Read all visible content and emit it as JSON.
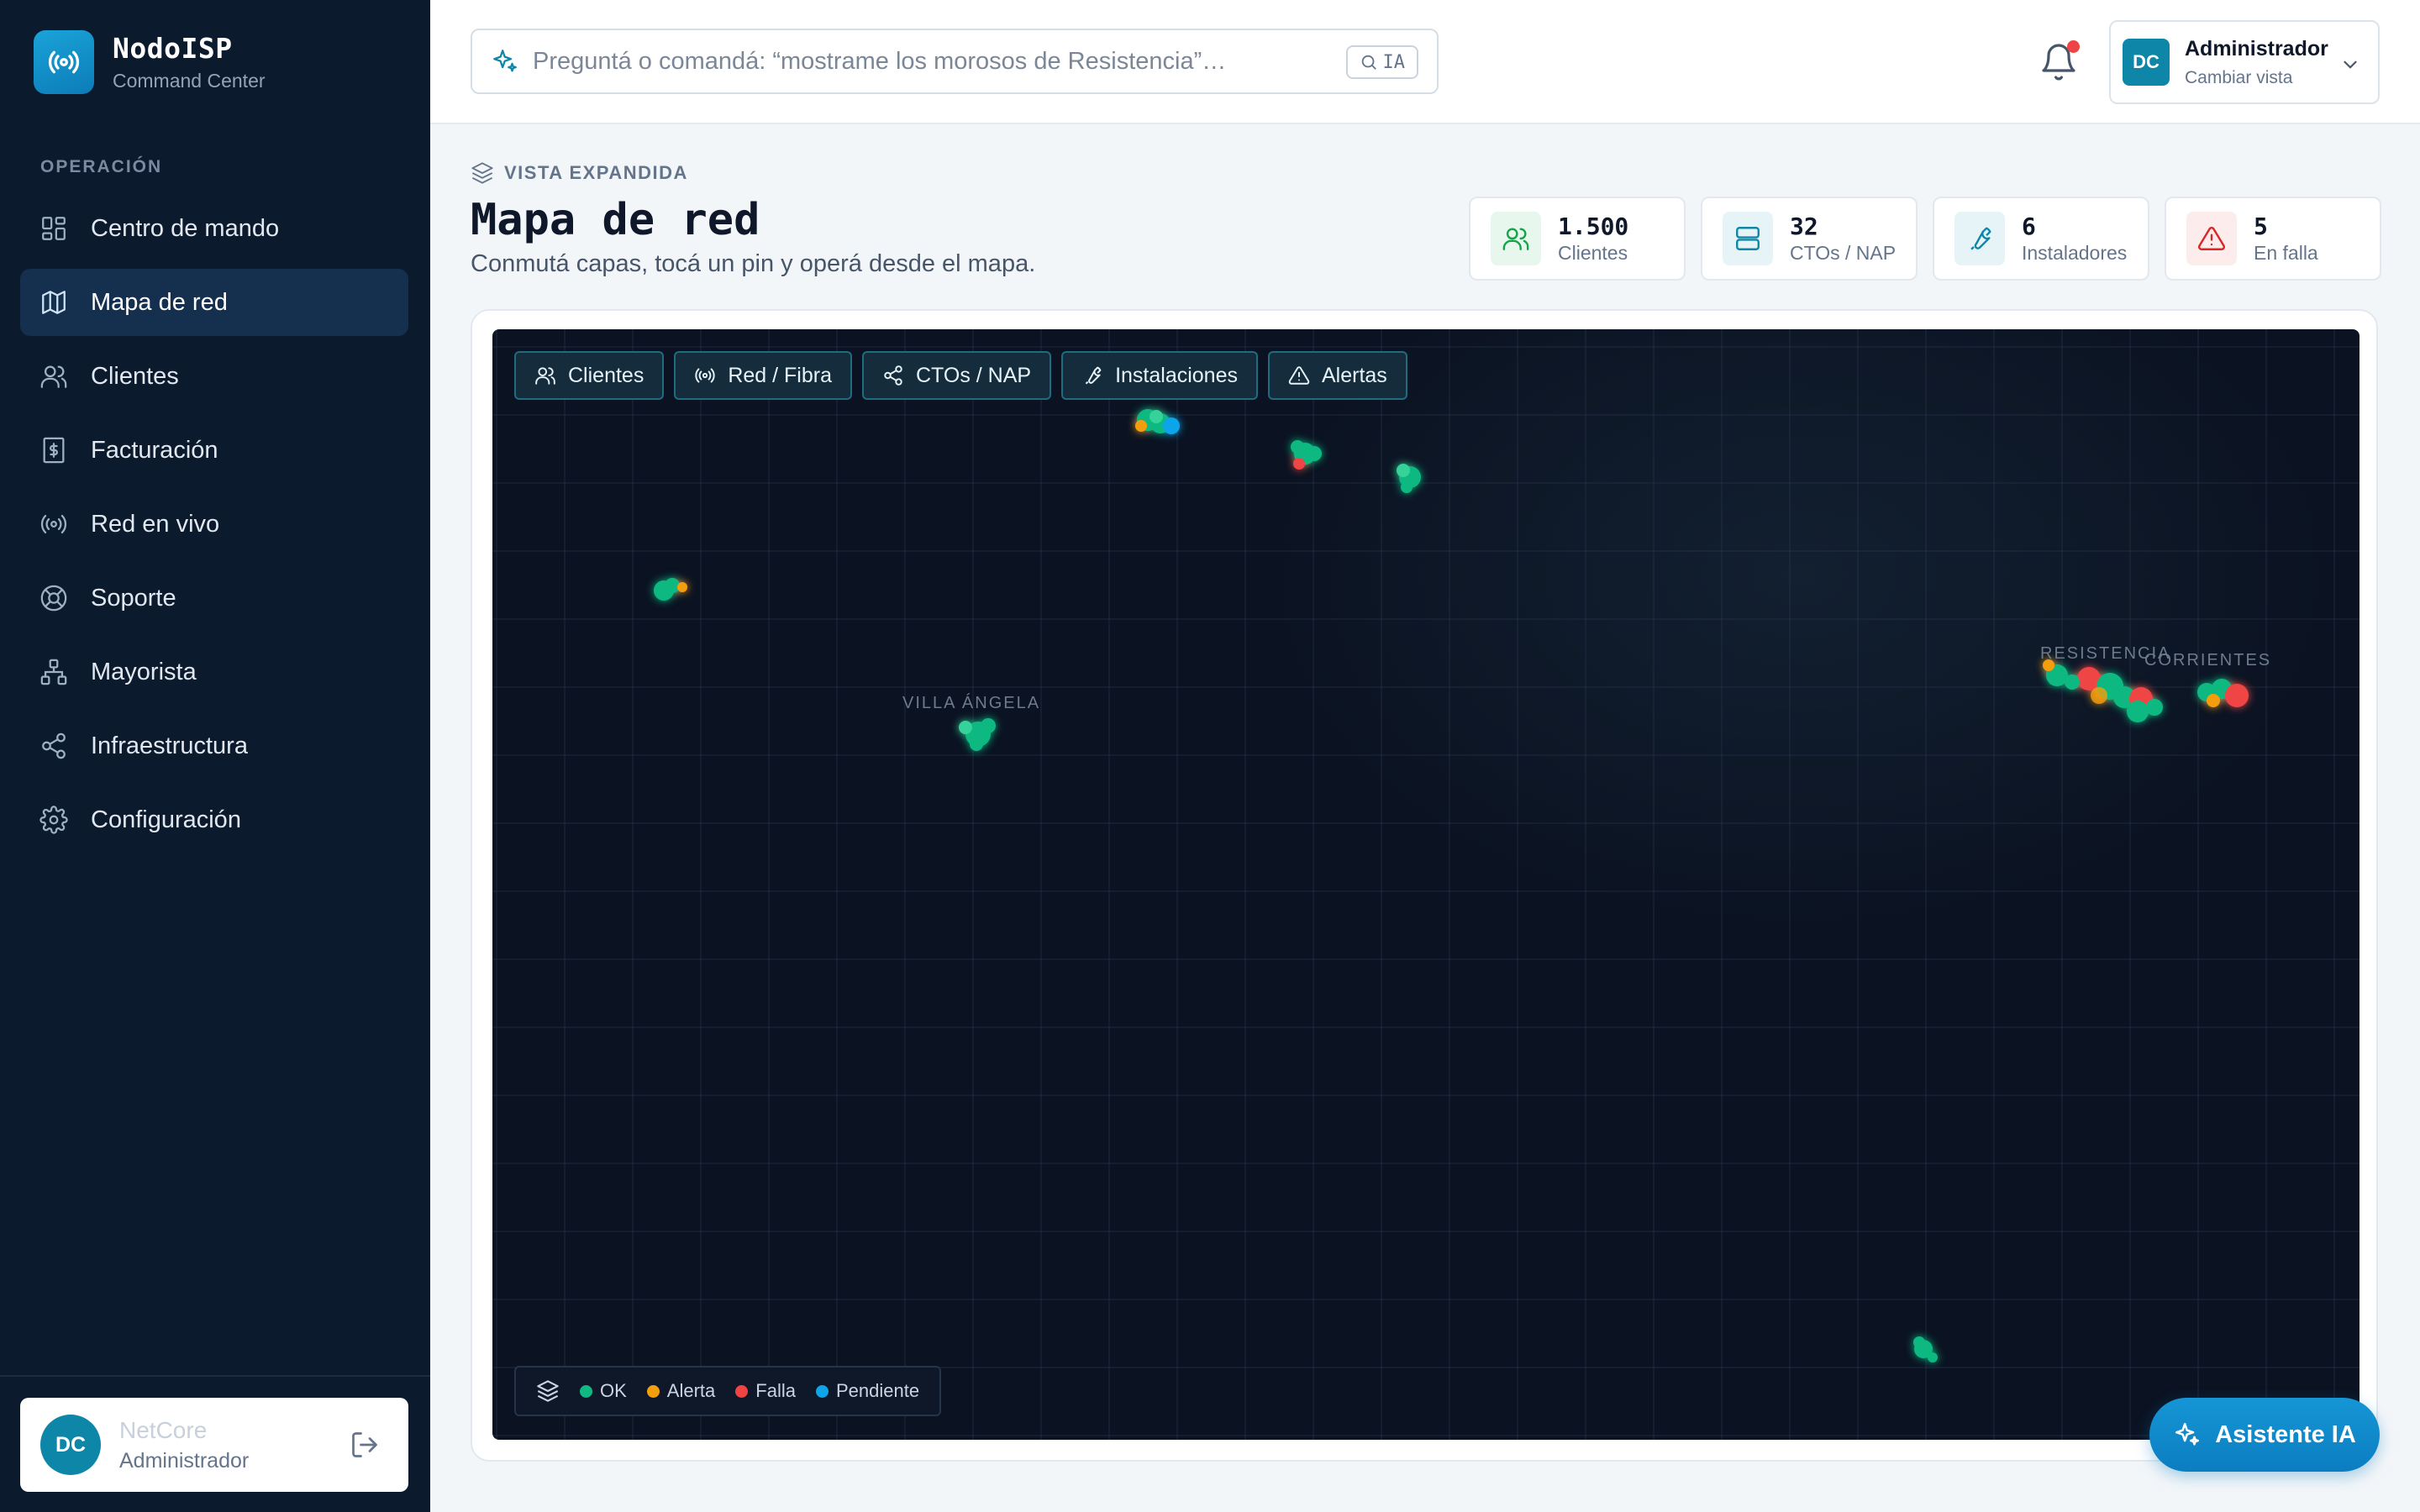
{
  "brand": {
    "name": "NodoISP",
    "subtitle": "Command Center"
  },
  "sidebar": {
    "section_label": "OPERACIÓN",
    "items": [
      {
        "label": "Centro de mando",
        "icon": "grid-icon",
        "active": false
      },
      {
        "label": "Mapa de red",
        "icon": "map-icon",
        "active": true
      },
      {
        "label": "Clientes",
        "icon": "users-icon",
        "active": false
      },
      {
        "label": "Facturación",
        "icon": "receipt-icon",
        "active": false
      },
      {
        "label": "Red en vivo",
        "icon": "broadcast-icon",
        "active": false
      },
      {
        "label": "Soporte",
        "icon": "lifebuoy-icon",
        "active": false
      },
      {
        "label": "Mayorista",
        "icon": "network-icon",
        "active": false
      },
      {
        "label": "Infraestructura",
        "icon": "share-icon",
        "active": false
      },
      {
        "label": "Configuración",
        "icon": "gear-icon",
        "active": false
      }
    ],
    "user": {
      "initials": "DC",
      "name": "NetCore",
      "role": "Administrador"
    }
  },
  "topbar": {
    "search_placeholder": "Preguntá o comandá: “mostrame los morosos de Resistencia”…",
    "search_chip": "IA",
    "account": {
      "initials": "DC",
      "name": "Administrador",
      "sub": "Cambiar vista"
    }
  },
  "page": {
    "breadcrumb": "VISTA EXPANDIDA",
    "title": "Mapa de red",
    "subtitle": "Conmutá capas, tocá un pin y operá desde el mapa."
  },
  "stats": [
    {
      "value": "1.500",
      "label": "Clientes",
      "icon": "users-icon",
      "color": "#16a34a",
      "bg": "#e8f7ee"
    },
    {
      "value": "32",
      "label": "CTOs / NAP",
      "icon": "server-icon",
      "color": "#0e86a8",
      "bg": "#e6f4f8"
    },
    {
      "value": "6",
      "label": "Instaladores",
      "icon": "wrench-icon",
      "color": "#0e86a8",
      "bg": "#e6f4f8"
    },
    {
      "value": "5",
      "label": "En falla",
      "icon": "alert-icon",
      "color": "#dc2626",
      "bg": "#fdecec"
    }
  ],
  "map": {
    "layers": [
      {
        "label": "Clientes",
        "icon": "users-icon"
      },
      {
        "label": "Red / Fibra",
        "icon": "broadcast-icon"
      },
      {
        "label": "CTOs / NAP",
        "icon": "share-icon"
      },
      {
        "label": "Instalaciones",
        "icon": "wrench-icon"
      },
      {
        "label": "Alertas",
        "icon": "alert-icon"
      }
    ],
    "cities": [
      {
        "name": "VILLA ÁNGELA"
      },
      {
        "name": "RESISTENCIA"
      },
      {
        "name": "CORRIENTES"
      }
    ],
    "legend": [
      {
        "label": "OK",
        "color": "#10b981"
      },
      {
        "label": "Alerta",
        "color": "#f59e0b"
      },
      {
        "label": "Falla",
        "color": "#ef4444"
      },
      {
        "label": "Pendiente",
        "color": "#0ea5e9"
      }
    ]
  },
  "assistant_button": "Asistente IA"
}
